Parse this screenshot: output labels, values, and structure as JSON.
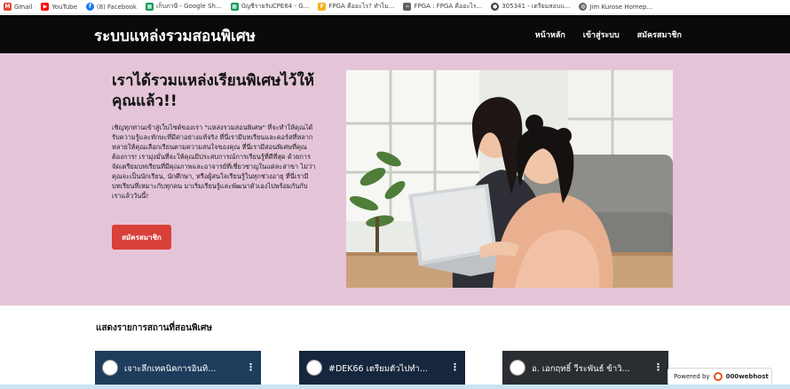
{
  "bookmarks": [
    {
      "label": "Gmail",
      "icon": "gmail-icon",
      "color": "#ea4335",
      "glyph": "M"
    },
    {
      "label": "YouTube",
      "icon": "youtube-icon",
      "color": "#ff0000",
      "glyph": "▶"
    },
    {
      "label": "(8) Facebook",
      "icon": "facebook-icon",
      "color": "#1877f2",
      "glyph": "f"
    },
    {
      "label": "เก็บภาษี - Google Sh...",
      "icon": "sheets-icon",
      "color": "#0f9d58",
      "glyph": "▦"
    },
    {
      "label": "บัญชีรายรับCPE64 - G...",
      "icon": "sheets-icon",
      "color": "#0f9d58",
      "glyph": "▦"
    },
    {
      "label": "FPGA คืออะไร? ทำไม...",
      "icon": "fpga-icon",
      "color": "#f2b21c",
      "glyph": "F"
    },
    {
      "label": "FPGA : FPGA คืออะไร...",
      "icon": "fpga-site-icon",
      "color": "#5f6368",
      "glyph": "~"
    },
    {
      "label": "305341 - เตรียมสอบแ...",
      "icon": "user-icon",
      "color": "#3c4043",
      "glyph": "●"
    },
    {
      "label": "Jim Kurose Homep...",
      "icon": "globe-icon",
      "color": "#5f6368",
      "glyph": "◍"
    }
  ],
  "navbar": {
    "brand": "ระบบแหล่งรวมสอนพิเศษ",
    "links": [
      "หน้าหลัก",
      "เข้าสู่ระบบ",
      "สมัครสมาชิก"
    ]
  },
  "hero": {
    "title": "เราได้รวมแหล่งเรียนพิเศษไว้ให้คุณแล้ว!!",
    "paragraph": "เชิญทุกท่านเข้าสู่เว็บไซต์ของเรา \"แหล่งรวมสอนพิเศษ\" ที่จะทำให้คุณได้รับความรู้และทักษะที่มีค่าอย่างแท้จริง ที่นี่เรามีบทเรียนและคอร์สที่หลากหลายให้คุณเลือกเรียนตามความสนใจของคุณ ที่นี่เรามีสอนพิเศษที่คุณต้องการ! เรามุ่งมั่นที่จะให้คุณมีประสบการณ์การเรียนรู้ที่ดีที่สุด ด้วยการจัดเตรียมบทเรียนที่มีคุณภาพและอาจารย์ที่เชี่ยวชาญในแต่ละสาขา ไม่ว่าคุณจะเป็นนักเรียน, นักศึกษา, หรือผู้สนใจเรียนรู้ในทุกช่วงอายุ ที่นี่เรามีบทเรียนที่เหมาะกับทุกคน มาเริ่มเรียนรู้และพัฒนาตัวเองไปพร้อมกันกับเราแล้ววันนี้!",
    "button": "สมัครสมาชิก"
  },
  "section": {
    "title": "แสดงรายการสถานที่สอนพิเศษ"
  },
  "videos": [
    {
      "title": "เจาะลึกเทคนิคการอินทิ...",
      "bg": "#1e3c5c"
    },
    {
      "title": "#DEK66 เตรียมตัวไปทำ...",
      "bg": "#15263d"
    },
    {
      "title": "อ. เอกฤทธิ์ วีระพันธ์ ข้าวิ...",
      "bg": "#2a2d31"
    }
  ],
  "powered": {
    "prefix": "Powered by",
    "brand": "000webhost"
  },
  "colors": {
    "navbar": "#0a0a0a",
    "hero_bg": "#e4c5d8",
    "button": "#d9403a"
  }
}
